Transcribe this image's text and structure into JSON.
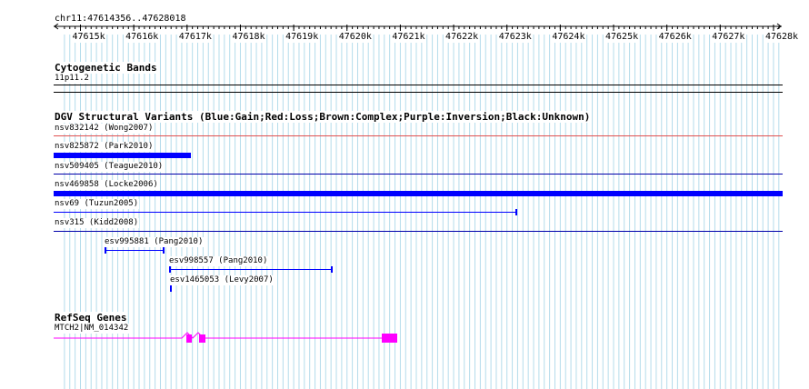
{
  "ruler": {
    "position": "chr11:47614356..47628018",
    "ticks": [
      "47615k",
      "47616k",
      "47617k",
      "47618k",
      "47619k",
      "47620k",
      "47621k",
      "47622k",
      "47623k",
      "47624k",
      "47625k",
      "47626k",
      "47627k",
      "47628k"
    ]
  },
  "cytoband": {
    "title": "Cytogenetic Bands",
    "band": "11p11.2"
  },
  "dgv": {
    "title": "DGV Structural Variants (Blue:Gain;Red:Loss;Brown:Complex;Purple:Inversion;Black:Unknown)",
    "variants": [
      {
        "label": "nsv832142 (Wong2007)",
        "color": "#e05050",
        "type": "loss"
      },
      {
        "label": "nsv825872 (Park2010)",
        "color": "#0000ff",
        "type": "gain"
      },
      {
        "label": "nsv509405 (Teague2010)",
        "color": "#0000aa",
        "type": "gain"
      },
      {
        "label": "nsv469858 (Locke2006)",
        "color": "#0000ff",
        "type": "gain"
      },
      {
        "label": "nsv69 (Tuzun2005)",
        "color": "#0000ff",
        "type": "gain"
      },
      {
        "label": "nsv315 (Kidd2008)",
        "color": "#0000aa",
        "type": "gain"
      },
      {
        "label": "esv995881 (Pang2010)",
        "color": "#0000ff",
        "type": "gain"
      },
      {
        "label": "esv998557 (Pang2010)",
        "color": "#0000ff",
        "type": "gain"
      },
      {
        "label": "esv1465053 (Levy2007)",
        "color": "#0000ff",
        "type": "gain"
      }
    ]
  },
  "refseq": {
    "title": "RefSeq Genes",
    "gene": "MTCH2|NM_014342",
    "color": "#ff00ff"
  },
  "colors": {
    "grid": "#b4dceb",
    "ruler": "#000000",
    "gain": "#0000ff",
    "loss": "#e05050",
    "gene": "#ff00ff"
  }
}
